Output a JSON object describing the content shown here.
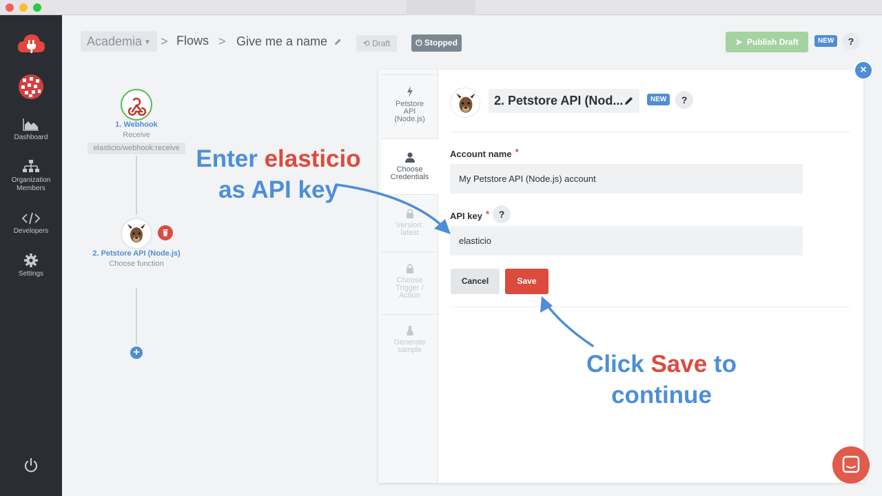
{
  "header": {
    "workspace": "Academia",
    "breadcrumb_flows": "Flows",
    "flow_name": "Give me a name",
    "draft_label": "Draft",
    "status_label": "Stopped",
    "publish_label": "Publish Draft",
    "new_badge": "NEW",
    "help": "?"
  },
  "sidebar": {
    "items": [
      {
        "label": "Dashboard",
        "icon": "chart-icon"
      },
      {
        "label": "Organization Members",
        "icon": "org-chart-icon"
      },
      {
        "label": "Developers",
        "icon": "code-icon"
      },
      {
        "label": "Settings",
        "icon": "gear-icon"
      }
    ]
  },
  "flow": {
    "nodes": [
      {
        "title": "1. Webhook",
        "subtitle": "Receive",
        "tag": "elasticio/webhook:receive"
      },
      {
        "title": "2. Petstore API (Node.js)",
        "subtitle": "Choose function"
      }
    ],
    "add": "+"
  },
  "panel": {
    "steps": [
      {
        "label": "Petstore API (Node.js)",
        "state": "normal"
      },
      {
        "label": "Choose Credentials",
        "state": "active"
      },
      {
        "label": "Version: latest",
        "state": "disabled"
      },
      {
        "label": "Choose Trigger / Action",
        "state": "disabled"
      },
      {
        "label": "Generate sample",
        "state": "disabled"
      }
    ],
    "component_name": "2. Petstore API (Nod...",
    "new_badge": "NEW",
    "help": "?",
    "account_name_label": "Account name",
    "account_name_value": "My Petstore API (Node.js) account",
    "api_key_label": "API key",
    "api_key_value": "elasticio",
    "required_mark": "*",
    "cancel_label": "Cancel",
    "save_label": "Save",
    "close": "×"
  },
  "annotations": {
    "enter_1a": "Enter ",
    "enter_1b": "elasticio",
    "enter_2": "as API key",
    "click_1a": "Click ",
    "click_1b": "Save",
    "click_1c": " to",
    "click_2": "continue"
  },
  "colors": {
    "accent_blue": "#4d8ed8",
    "danger_red": "#db4b3e",
    "success_green": "#a4d3a1",
    "sidebar_bg": "#2a2d33"
  }
}
